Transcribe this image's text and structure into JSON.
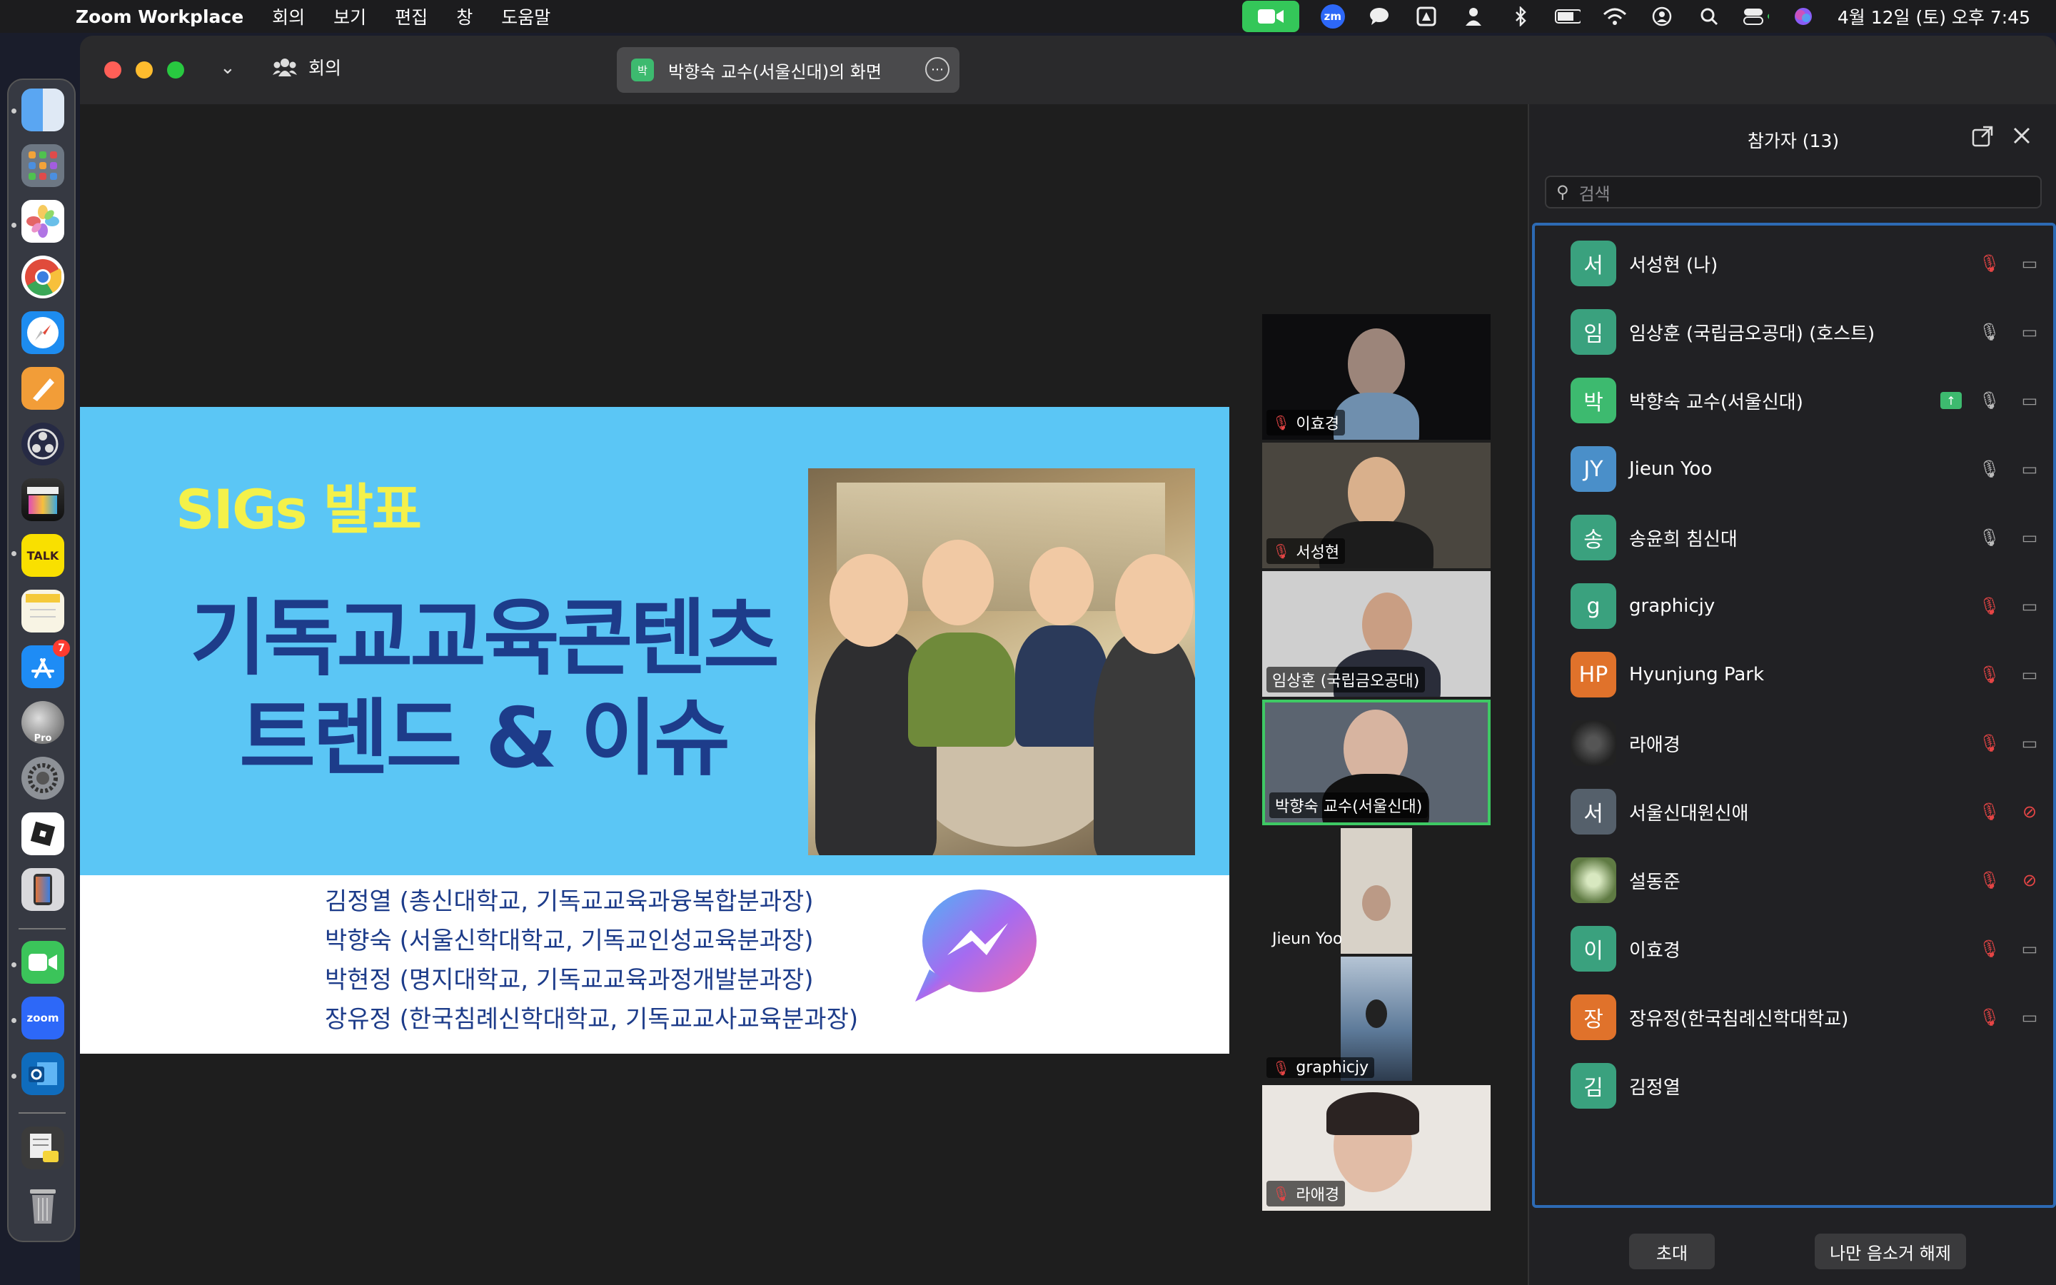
{
  "menubar": {
    "app_name": "Zoom Workplace",
    "items": [
      "회의",
      "보기",
      "편집",
      "창",
      "도움말"
    ],
    "clock": "4월 12일 (토) 오후 7:45",
    "status_icons": [
      "zoom-camera-icon",
      "zoom-app-icon",
      "messages-icon",
      "upload-icon",
      "user-icon",
      "bluetooth-icon",
      "battery-icon",
      "wifi-icon",
      "account-icon",
      "search-icon",
      "control-center-icon",
      "siri-icon"
    ],
    "zm_label": "zm"
  },
  "dock": {
    "apps": [
      "finder",
      "launchpad",
      "photos",
      "chrome",
      "safari",
      "pages",
      "obs",
      "final-cut",
      "kakaotalk",
      "notes",
      "app-store",
      "logic-pro",
      "system-settings",
      "roblox",
      "simulator",
      "facetime",
      "zoom",
      "outlook",
      "document",
      "trash"
    ],
    "talk_label": "TALK",
    "zoom_label": "zoom",
    "pro_label": "Pro",
    "app_store_badge": "7"
  },
  "window": {
    "meeting_label": "회의",
    "share_badge": "박",
    "share_title": "박향숙 교수(서울신대)의 화면"
  },
  "slide": {
    "sig_title": "SIGs 발표",
    "main_line1": "기독교교육콘텐츠",
    "main_line2": "트렌드 & 이슈",
    "authors": [
      "김정열 (총신대학교, 기독교교육과융복합분과장)",
      "박향숙 (서울신학대학교, 기독교인성교육분과장)",
      "박현정 (명지대학교, 기독교교육과정개발분과장)",
      "장유정 (한국침례신학대학교, 기독교교사교육분과장)"
    ]
  },
  "video_tiles": [
    {
      "name": "이효경",
      "muted": true
    },
    {
      "name": "서성현",
      "muted": true
    },
    {
      "name": "임상훈 (국립금오공대)",
      "muted": false
    },
    {
      "name": "박향숙 교수(서울신대)",
      "muted": false,
      "active_speaker": true
    },
    {
      "name": "Jieun Yoo",
      "muted": false
    },
    {
      "name": "graphicjy",
      "muted": true
    },
    {
      "name": "라애경",
      "muted": true
    }
  ],
  "participants_panel": {
    "title": "참가자 (13)",
    "search_placeholder": "검색",
    "participants": [
      {
        "initial": "서",
        "name": "서성현 (나)",
        "color": "#3aa17e",
        "mic": "muted",
        "cam": "off"
      },
      {
        "initial": "임",
        "name": "임상훈 (국립금오공대) (호스트)",
        "color": "#3aa17e",
        "mic": "on",
        "cam": "off"
      },
      {
        "initial": "박",
        "name": "박향숙 교수(서울신대)",
        "color": "#3dba6f",
        "mic": "on",
        "cam": "off",
        "sharing": true
      },
      {
        "initial": "JY",
        "name": "Jieun Yoo",
        "color": "#4a8fc9",
        "mic": "on",
        "cam": "off"
      },
      {
        "initial": "송",
        "name": "송윤희 침신대",
        "color": "#3aa17e",
        "mic": "on",
        "cam": "off"
      },
      {
        "initial": "g",
        "name": "graphicjy",
        "color": "#3aa17e",
        "mic": "muted",
        "cam": "off"
      },
      {
        "initial": "HP",
        "name": "Hyunjung Park",
        "color": "#e0722b",
        "mic": "muted",
        "cam": "off"
      },
      {
        "initial": "",
        "name": "라애경",
        "color": "#55606b",
        "mic": "muted",
        "cam": "off",
        "photo": true
      },
      {
        "initial": "서",
        "name": "서울신대원신애",
        "color": "#55606b",
        "mic": "muted",
        "cam": "blocked"
      },
      {
        "initial": "",
        "name": "설동준",
        "color": "#8da86a",
        "mic": "muted",
        "cam": "blocked",
        "photo": true
      },
      {
        "initial": "이",
        "name": "이효경",
        "color": "#3aa17e",
        "mic": "muted",
        "cam": "off"
      },
      {
        "initial": "장",
        "name": "장유정(한국침례신학대학교)",
        "color": "#e0722b",
        "mic": "muted",
        "cam": "off"
      },
      {
        "initial": "김",
        "name": "김정열",
        "color": "#3aa17e",
        "mic": "none",
        "cam": "none"
      }
    ],
    "invite_label": "초대",
    "unmute_self_label": "나만 음소거 해제"
  }
}
